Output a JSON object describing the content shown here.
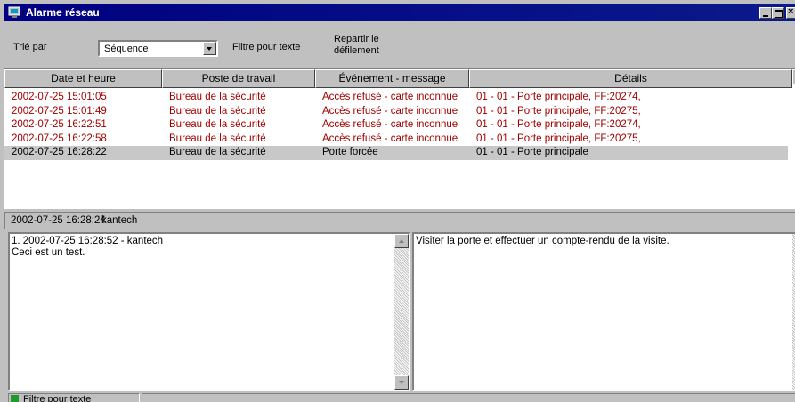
{
  "window": {
    "title": "Alarme réseau"
  },
  "toolbar": {
    "sort_label": "Trié par",
    "sort_value": "Séquence",
    "filter_label": "Filtre pour texte",
    "scroll_label_line1": "Repartir le",
    "scroll_label_line2": "défilement"
  },
  "grid": {
    "columns": [
      "Date et heure",
      "Poste de travail",
      "Événement - message",
      "Détails"
    ],
    "rows": [
      {
        "date": "2002-07-25 15:01:05",
        "workstation": "Bureau de la sécurité",
        "event": "Accès refusé - carte inconnue",
        "details": "01 - 01 - Porte principale, FF:20274,"
      },
      {
        "date": "2002-07-25 15:01:49",
        "workstation": "Bureau de la sécurité",
        "event": "Accès refusé - carte inconnue",
        "details": "01 - 01 - Porte principale, FF:20275,"
      },
      {
        "date": "2002-07-25 16:22:51",
        "workstation": "Bureau de la sécurité",
        "event": "Accès refusé - carte inconnue",
        "details": "01 - 01 - Porte principale, FF:20274,"
      },
      {
        "date": "2002-07-25 16:22:58",
        "workstation": "Bureau de la sécurité",
        "event": "Accès refusé - carte inconnue",
        "details": "01 - 01 - Porte principale, FF:20275,"
      },
      {
        "date": "2002-07-25 16:28:22",
        "workstation": "Bureau de la sécurité",
        "event": "Porte forcée",
        "details": "01 - 01 - Porte principale"
      }
    ]
  },
  "info": {
    "timestamp": "2002-07-25 16:28:24",
    "user": "kantech"
  },
  "comments": {
    "line1": "1. 2002-07-25 16:28:52 - kantech",
    "line2": "Ceci est un test."
  },
  "instructions": {
    "text": "Visiter la porte et effectuer un compte-rendu de la visite."
  },
  "status": {
    "text": "Filtre pour texte"
  },
  "colors": {
    "titlebar": "#000080",
    "alarm_text": "#a00000",
    "status_led": "#1f9a2c",
    "selected_row": "#c8c8c8"
  }
}
